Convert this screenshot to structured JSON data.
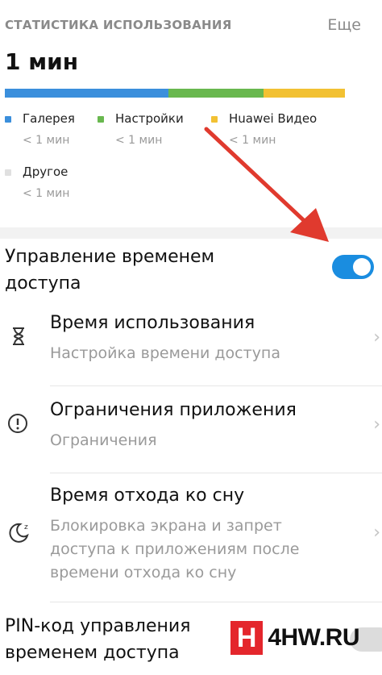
{
  "usage": {
    "section_title": "СТАТИСТИКА ИСПОЛЬЗОВАНИЯ",
    "more_label": "Еще",
    "total": "1 мин",
    "segments": [
      {
        "color": "#3b8fdc",
        "share": 0.48
      },
      {
        "color": "#69b84f",
        "share": 0.28
      },
      {
        "color": "#f2c133",
        "share": 0.24
      }
    ],
    "legend": [
      {
        "name": "Галерея",
        "value": "< 1 мин",
        "color": "#3b8fdc"
      },
      {
        "name": "Настройки",
        "value": "< 1 мин",
        "color": "#69b84f"
      },
      {
        "name": "Huawei Видео",
        "value": "< 1 мин",
        "color": "#f2c133"
      },
      {
        "name": "Другое",
        "value": "< 1 мин",
        "color": "#e0e0e0"
      }
    ]
  },
  "access_control": {
    "label": "Управление временем доступа",
    "enabled": true,
    "accent": "#1a8de0"
  },
  "menu": [
    {
      "icon": "hourglass-icon",
      "title": "Время использования",
      "subtitle": "Настройка времени доступа"
    },
    {
      "icon": "alert-circle-icon",
      "title": "Ограничения приложения",
      "subtitle": "Ограничения"
    },
    {
      "icon": "moon-sleep-icon",
      "title": "Время отхода ко сну",
      "subtitle": "Блокировка экрана и запрет доступа к приложениям после времени отхода ко сну"
    }
  ],
  "pin": {
    "label": "PIN-код управления временем доступа",
    "enabled": false
  },
  "watermark": {
    "logo_letter": "H",
    "text": "4HW.RU"
  },
  "annotation": {
    "arrow_color": "#e03a2e"
  }
}
